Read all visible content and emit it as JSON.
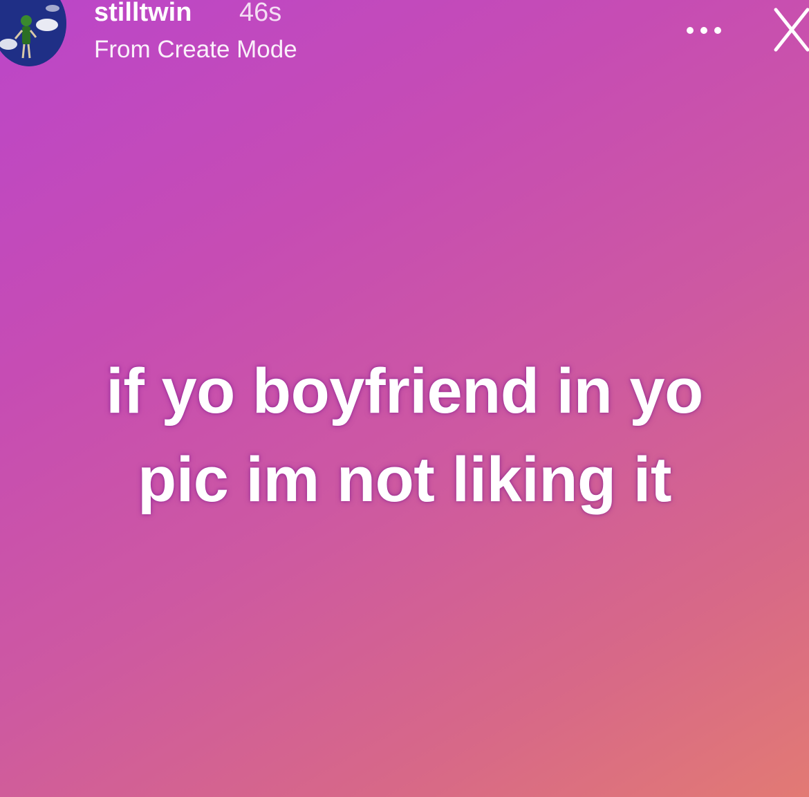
{
  "story": {
    "username": "stilltwin",
    "timestamp": "46s",
    "subtitle": "From Create Mode",
    "caption_lines": [
      "if yo boyfriend in yo",
      "pic  im not liking it"
    ]
  },
  "icons": {
    "avatar": "avatar",
    "more": "more-options-icon",
    "close": "close-icon"
  },
  "colors": {
    "gradient_top_left": "#bb46c9",
    "gradient_bottom_right": "#e27a74",
    "text": "#ffffff"
  }
}
